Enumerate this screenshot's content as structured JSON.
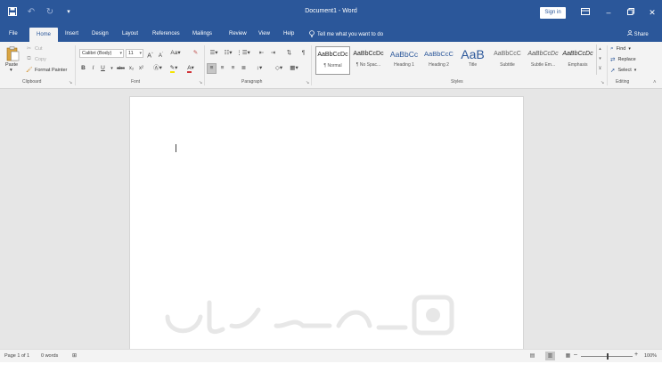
{
  "window": {
    "title": "Document1 - Word",
    "signin_label": "Sign in"
  },
  "qat_icons": [
    "save-icon",
    "undo-icon",
    "redo-icon",
    "customize-qat-icon"
  ],
  "tabs": [
    {
      "label": "File"
    },
    {
      "label": "Home"
    },
    {
      "label": "Insert"
    },
    {
      "label": "Design"
    },
    {
      "label": "Layout"
    },
    {
      "label": "References"
    },
    {
      "label": "Mailings"
    },
    {
      "label": "Review"
    },
    {
      "label": "View"
    },
    {
      "label": "Help"
    }
  ],
  "active_tab": "Home",
  "tell_me": "Tell me what you want to do",
  "share_label": "Share",
  "clipboard": {
    "paste": "Paste",
    "cut": "Cut",
    "copy": "Copy",
    "format_painter": "Format Painter",
    "label": "Clipboard"
  },
  "font": {
    "name": "Calibri (Body)",
    "size": "11",
    "label": "Font",
    "buttons": [
      "B",
      "I",
      "U",
      "abc",
      "x₂",
      "x²"
    ]
  },
  "paragraph": {
    "label": "Paragraph"
  },
  "styles": {
    "label": "Styles",
    "items": [
      {
        "sample": "AaBbCcDc",
        "name": "¶ Normal"
      },
      {
        "sample": "AaBbCcDc",
        "name": "¶ No Spac..."
      },
      {
        "sample": "AaBbCc",
        "name": "Heading 1"
      },
      {
        "sample": "AaBbCcC",
        "name": "Heading 2"
      },
      {
        "sample": "AaB",
        "name": "Title"
      },
      {
        "sample": "AaBbCcC",
        "name": "Subtitle"
      },
      {
        "sample": "AaBbCcDc",
        "name": "Subtle Em..."
      },
      {
        "sample": "AaBbCcDc",
        "name": "Emphasis"
      }
    ]
  },
  "editing": {
    "label": "Editing",
    "find": "Find",
    "replace": "Replace",
    "select": "Select"
  },
  "status": {
    "page": "Page 1 of 1",
    "words": "0 words",
    "zoom": "100%"
  },
  "colors": {
    "accent": "#2b579a",
    "ribbon": "#f3f3f3",
    "canvas": "#e6e6e6"
  }
}
